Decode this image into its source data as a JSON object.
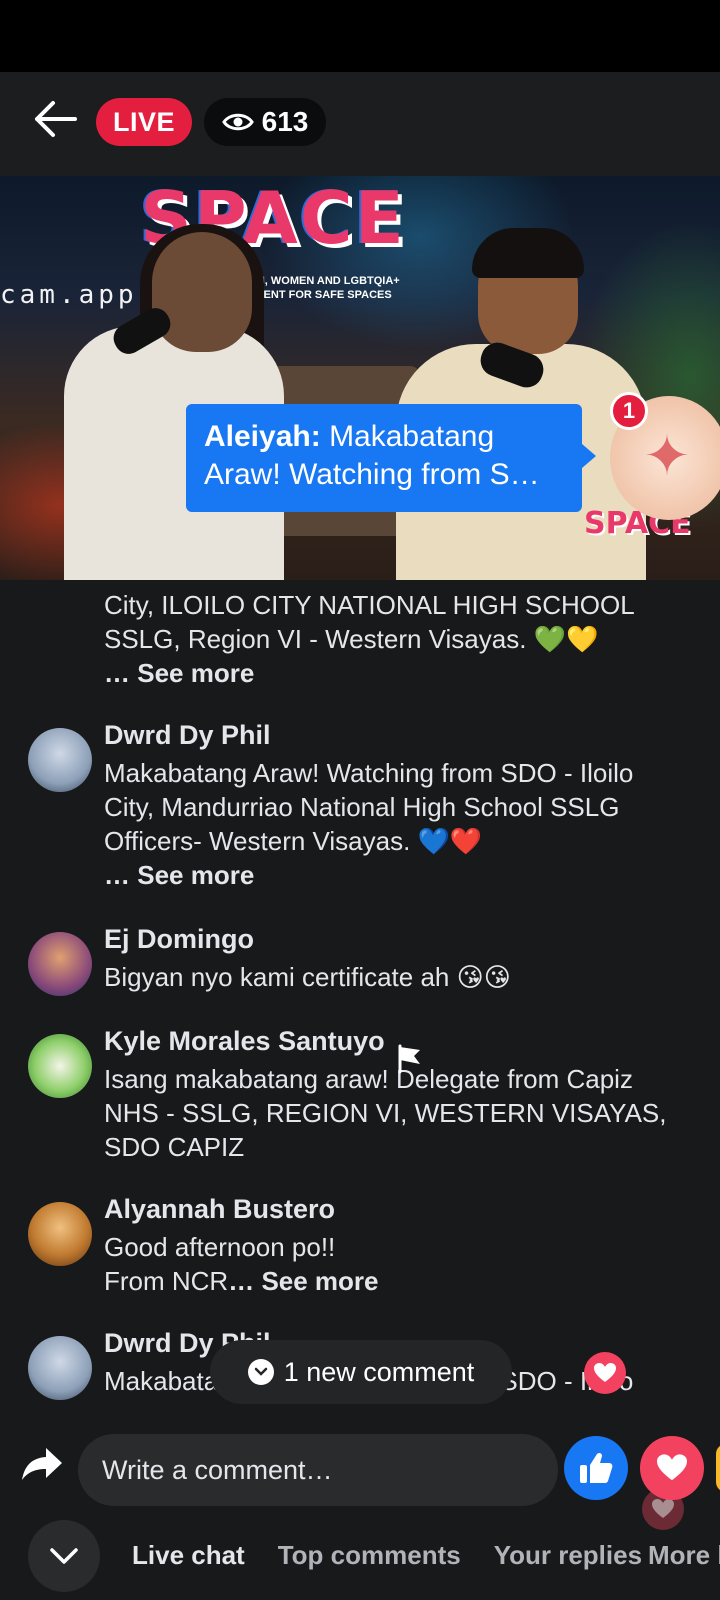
{
  "header": {
    "live_label": "LIVE",
    "viewer_count": "613"
  },
  "video": {
    "logo_text": "SPACE",
    "banner_text": "OF MEN, WOMEN AND LGBTQIA+ MOVEMENT FOR SAFE SPACES",
    "watermark": "cam.app",
    "corner_logo": "SPACE"
  },
  "featured_comment": {
    "author": "Aleiyah:",
    "text": "Makabatang Araw! Watching from S…",
    "notification_count": "1"
  },
  "comments": [
    {
      "name": "",
      "text": "City, ILOILO CITY NATIONAL HIGH SCHOOL SSLG, Region VI - Western Visayas. 💚💛",
      "see_more": "… See more"
    },
    {
      "name": "Dwrd Dy Phil",
      "text": "Makabatang Araw! Watching from SDO - Iloilo City, Mandurriao National High School SSLG Officers- Western Visayas. 💙❤️",
      "see_more": "… See more"
    },
    {
      "name": "Ej Domingo",
      "text": "Bigyan nyo kami certificate ah 😘😘"
    },
    {
      "name": "Kyle Morales Santuyo",
      "text": "Isang makabatang araw! Delegate from Capiz NHS - SSLG, REGION VI, WESTERN VISAYAS, SDO CAPIZ"
    },
    {
      "name": "Alyannah Bustero",
      "text_line1": "Good afternoon po!!",
      "text_line2": "From NCR",
      "see_more": "… See more"
    },
    {
      "name": "Dwrd Dy Phil",
      "text": "Makabatang Araw! Watching from SDO - Iloilo"
    }
  ],
  "new_comment_pill": "1 new comment",
  "composer": {
    "placeholder": "Write a comment…"
  },
  "tabs": [
    "Live chat",
    "Top comments",
    "Your replies"
  ],
  "tab_more": "More l",
  "colors": {
    "live_red": "#e41e3f",
    "bubble_blue": "#1877f2",
    "background": "#18191a"
  }
}
